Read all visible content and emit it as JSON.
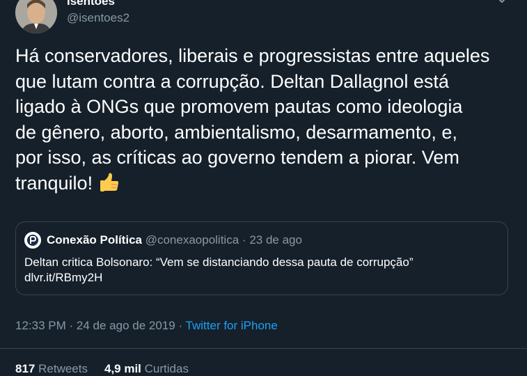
{
  "author": {
    "name": "isentoes",
    "handle": "@isentoes2"
  },
  "tweet": {
    "lines": [
      "Há conservadores, liberais e progressistas entre aqueles",
      "que lutam contra a corrupção. Deltan Dallagnol está",
      "ligado à ONGs que promovem pautas como ideologia",
      "de gênero, aborto, ambientalismo, desarmamento, e,",
      "por isso, as críticas ao governo tendem a piorar. Vem",
      "tranquilo!"
    ],
    "emoji": "thumbs-up-icon"
  },
  "quoted": {
    "name": "Conexão Política",
    "handle": "@conexaopolitica",
    "separator": "·",
    "date": "23 de ago",
    "body_line1": "Deltan critica Bolsonaro: “Vem se distanciando dessa pauta de corrupção”",
    "body_line2": "dlvr.it/RBmy2H"
  },
  "meta": {
    "time": "12:33 PM",
    "separator1": "·",
    "date": "24 de ago de 2019",
    "separator2": "·",
    "source": "Twitter for iPhone"
  },
  "stats": {
    "retweets_count": "817",
    "retweets_label": "Retweets",
    "likes_count": "4,9 mil",
    "likes_label": "Curtidas"
  },
  "colors": {
    "background": "#15202b",
    "secondary_text": "#8899a6",
    "link": "#1da1f2",
    "border": "#38444d"
  }
}
